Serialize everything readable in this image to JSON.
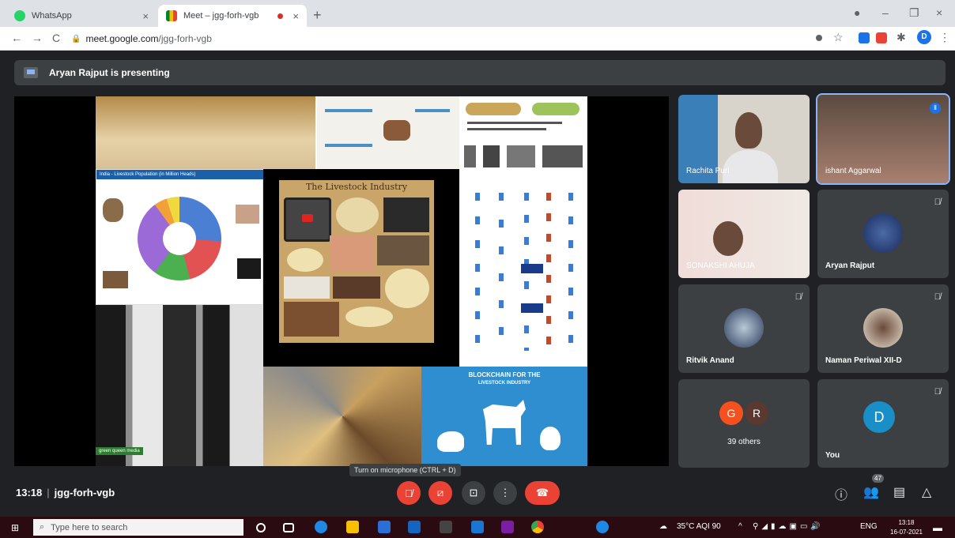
{
  "browser": {
    "tabs": [
      {
        "title": "WhatsApp",
        "close": "×"
      },
      {
        "title": "Meet – jgg-forh-vgb",
        "close": "×"
      }
    ],
    "new_tab": "+",
    "window_controls": {
      "minimize": "–",
      "maximize": "❐",
      "close": "×"
    },
    "nav": {
      "back": "←",
      "forward": "→",
      "reload": "C"
    },
    "url_host": "meet.google.com",
    "url_path": "/jgg-forh-vgb",
    "profile_initial": "D"
  },
  "meet": {
    "presenting_banner": "Aryan Rajput is presenting",
    "slide": {
      "center_title": "The Livestock Industry",
      "chart_title": "India - Livestock Population (in Million Heads)",
      "blockchain_title_line1": "BLOCKCHAIN FOR THE",
      "blockchain_title_line2": "LIVESTOCK INDUSTRY",
      "caption_tag": "green queen media"
    },
    "participants": [
      {
        "name": "Rachita Puri"
      },
      {
        "name": "ishant Aggarwal"
      },
      {
        "name": "SONAKSHI AHUJA"
      },
      {
        "name": "Aryan Rajput"
      },
      {
        "name": "Ritvik Anand"
      },
      {
        "name": "Naman Periwal XII-D"
      },
      {
        "name": "39 others",
        "avatar_letters": [
          "G",
          "R"
        ]
      },
      {
        "name": "You",
        "avatar_letter": "D"
      }
    ],
    "bottom": {
      "time": "13:18",
      "separator": "|",
      "meeting_code": "jgg-forh-vgb",
      "tooltip": "Turn on microphone (CTRL + D)",
      "participant_count": "47"
    }
  },
  "taskbar": {
    "search_placeholder": "Type here to search",
    "weather": "35°C AQI 90",
    "language": "ENG",
    "time": "13:18",
    "date": "16-07-2021"
  }
}
